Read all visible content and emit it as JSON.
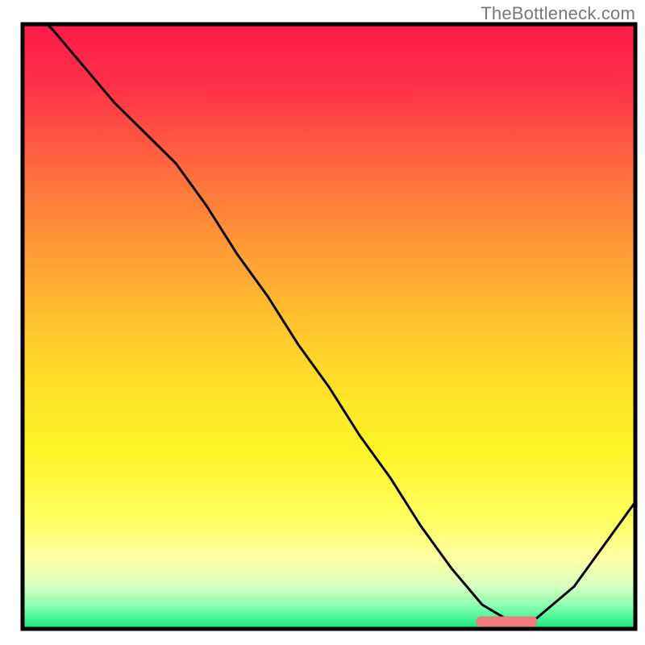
{
  "watermark": "TheBottleneck.com",
  "chart_data": {
    "type": "line",
    "title": "",
    "xlabel": "",
    "ylabel": "",
    "xlim": [
      0,
      100
    ],
    "ylim": [
      0,
      100
    ],
    "x": [
      0,
      5,
      10,
      15,
      20,
      25,
      30,
      35,
      40,
      45,
      50,
      55,
      60,
      65,
      70,
      75,
      80,
      83,
      90,
      95,
      100
    ],
    "values": [
      104,
      99,
      93,
      87,
      82,
      77,
      70,
      62,
      55,
      47,
      40,
      32,
      25,
      17,
      10,
      4,
      1,
      1,
      7,
      14,
      21
    ],
    "marker_segment": {
      "x_start": 74,
      "x_end": 84,
      "y": 1.2,
      "color": "#ef7b7b"
    },
    "gradient_stops": [
      {
        "offset": 0.0,
        "color": "#ff1a4a"
      },
      {
        "offset": 0.1,
        "color": "#ff3048"
      },
      {
        "offset": 0.25,
        "color": "#ff6e3e"
      },
      {
        "offset": 0.4,
        "color": "#ffa534"
      },
      {
        "offset": 0.55,
        "color": "#ffd52a"
      },
      {
        "offset": 0.7,
        "color": "#fff425"
      },
      {
        "offset": 0.82,
        "color": "#ffff60"
      },
      {
        "offset": 0.88,
        "color": "#ffffa0"
      },
      {
        "offset": 0.93,
        "color": "#d8ffc0"
      },
      {
        "offset": 0.965,
        "color": "#80ffb0"
      },
      {
        "offset": 1.0,
        "color": "#10e878"
      }
    ],
    "border_color": "#000000",
    "line_color": "#000000"
  }
}
